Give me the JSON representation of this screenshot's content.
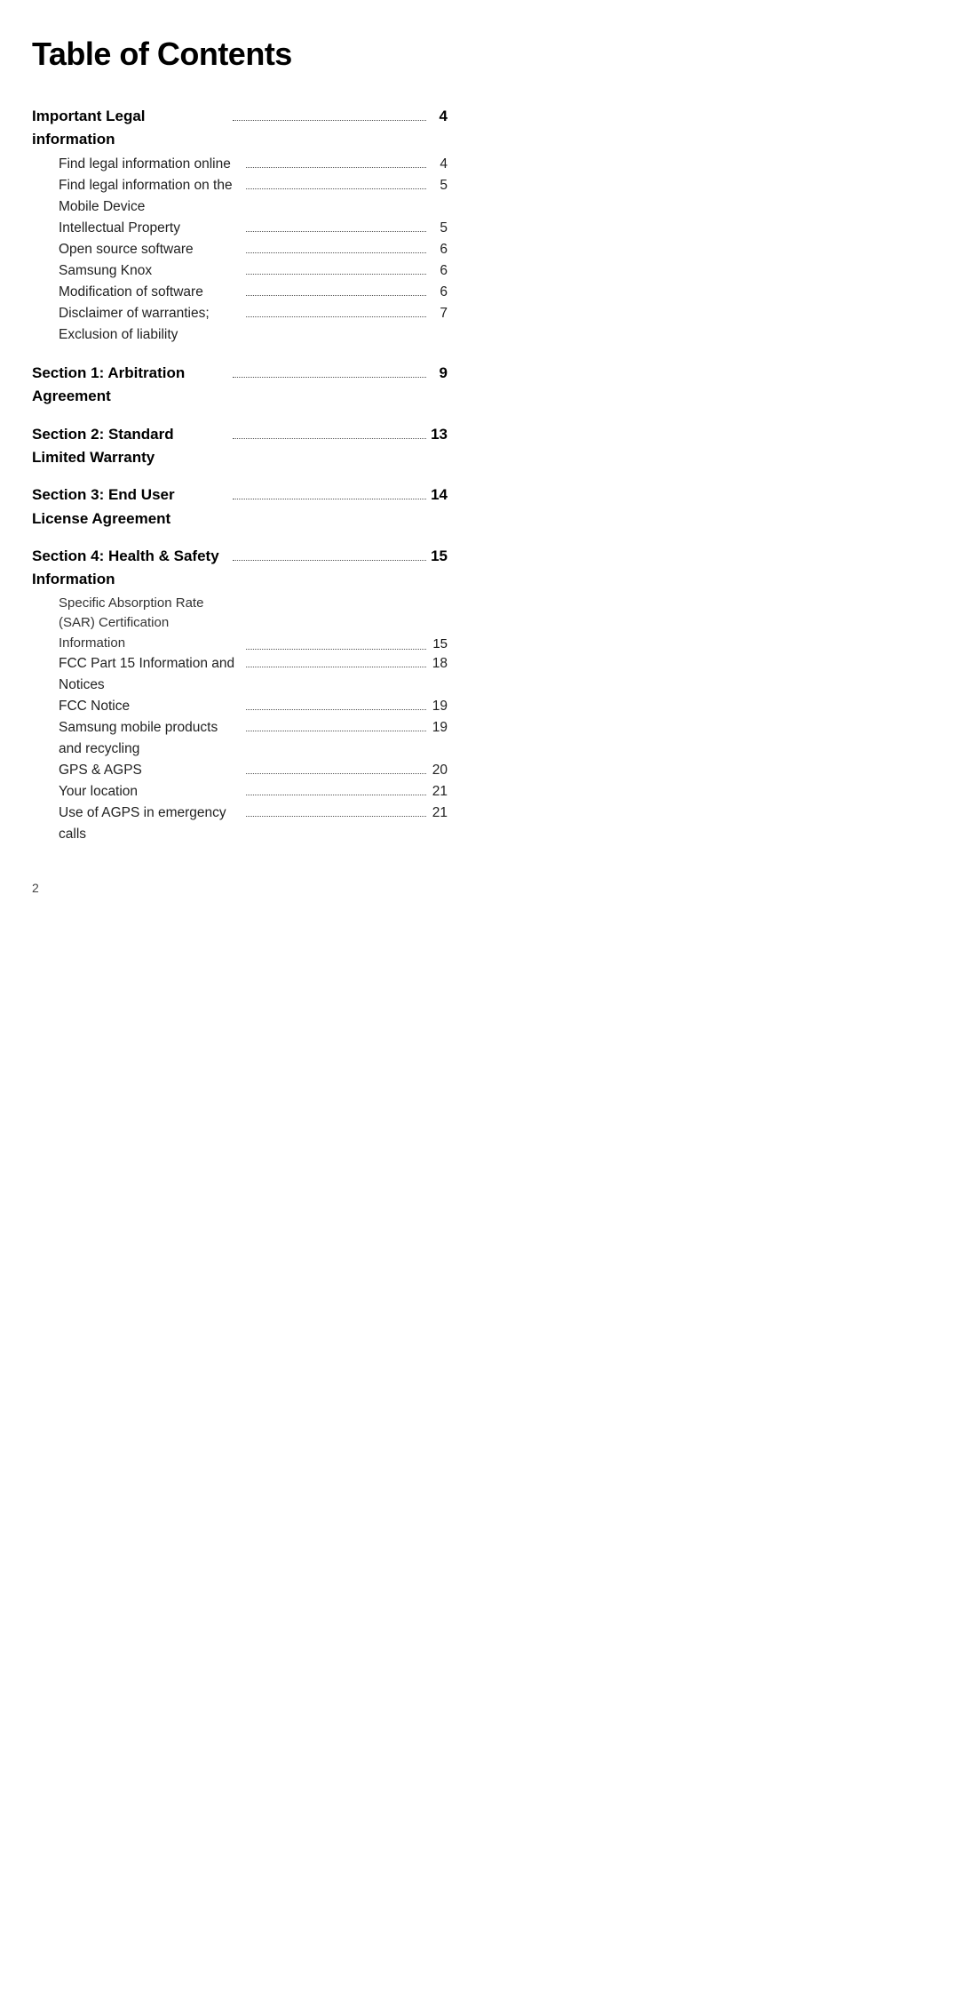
{
  "title": "Table of Contents",
  "entries": [
    {
      "label": "Important Legal information",
      "page": "4",
      "level": "section",
      "id": "important-legal-info"
    },
    {
      "label": "Find legal information online",
      "page": "4",
      "level": "sub",
      "id": "find-legal-online"
    },
    {
      "label": "Find legal information on the Mobile Device",
      "page": "5",
      "level": "sub",
      "id": "find-legal-mobile"
    },
    {
      "label": "Intellectual Property",
      "page": "5",
      "level": "sub",
      "id": "intellectual-property"
    },
    {
      "label": "Open source software",
      "page": "6",
      "level": "sub",
      "id": "open-source-software"
    },
    {
      "label": "Samsung Knox",
      "page": "6",
      "level": "sub",
      "id": "samsung-knox"
    },
    {
      "label": "Modification of software",
      "page": "6",
      "level": "sub",
      "id": "modification-software"
    },
    {
      "label": "Disclaimer of warranties; Exclusion of liability",
      "page": "7",
      "level": "sub",
      "id": "disclaimer-warranties"
    },
    {
      "label": "Section 1: Arbitration Agreement",
      "page": "9",
      "level": "section",
      "id": "section1"
    },
    {
      "label": "Section 2: Standard Limited Warranty",
      "page": "13",
      "level": "section",
      "id": "section2"
    },
    {
      "label": "Section 3: End User License Agreement",
      "page": "14",
      "level": "section",
      "id": "section3"
    },
    {
      "label": "Section 4: Health & Safety Information",
      "page": "15",
      "level": "section",
      "id": "section4"
    },
    {
      "label": "Specific Absorption Rate (SAR) Certification Information",
      "page": "15",
      "level": "sub-multi",
      "id": "sar"
    },
    {
      "label": "FCC Part 15 Information and Notices",
      "page": "18",
      "level": "sub",
      "id": "fcc-part15"
    },
    {
      "label": "FCC Notice",
      "page": "19",
      "level": "sub",
      "id": "fcc-notice"
    },
    {
      "label": "Samsung mobile products and recycling",
      "page": "19",
      "level": "sub",
      "id": "samsung-recycling"
    },
    {
      "label": "GPS & AGPS",
      "page": "20",
      "level": "sub",
      "id": "gps-agps"
    },
    {
      "label": "Your location",
      "page": "21",
      "level": "sub",
      "id": "your-location"
    },
    {
      "label": "Use of AGPS in emergency calls",
      "page": "21",
      "level": "sub",
      "id": "agps-emergency"
    }
  ],
  "page_number": "2"
}
